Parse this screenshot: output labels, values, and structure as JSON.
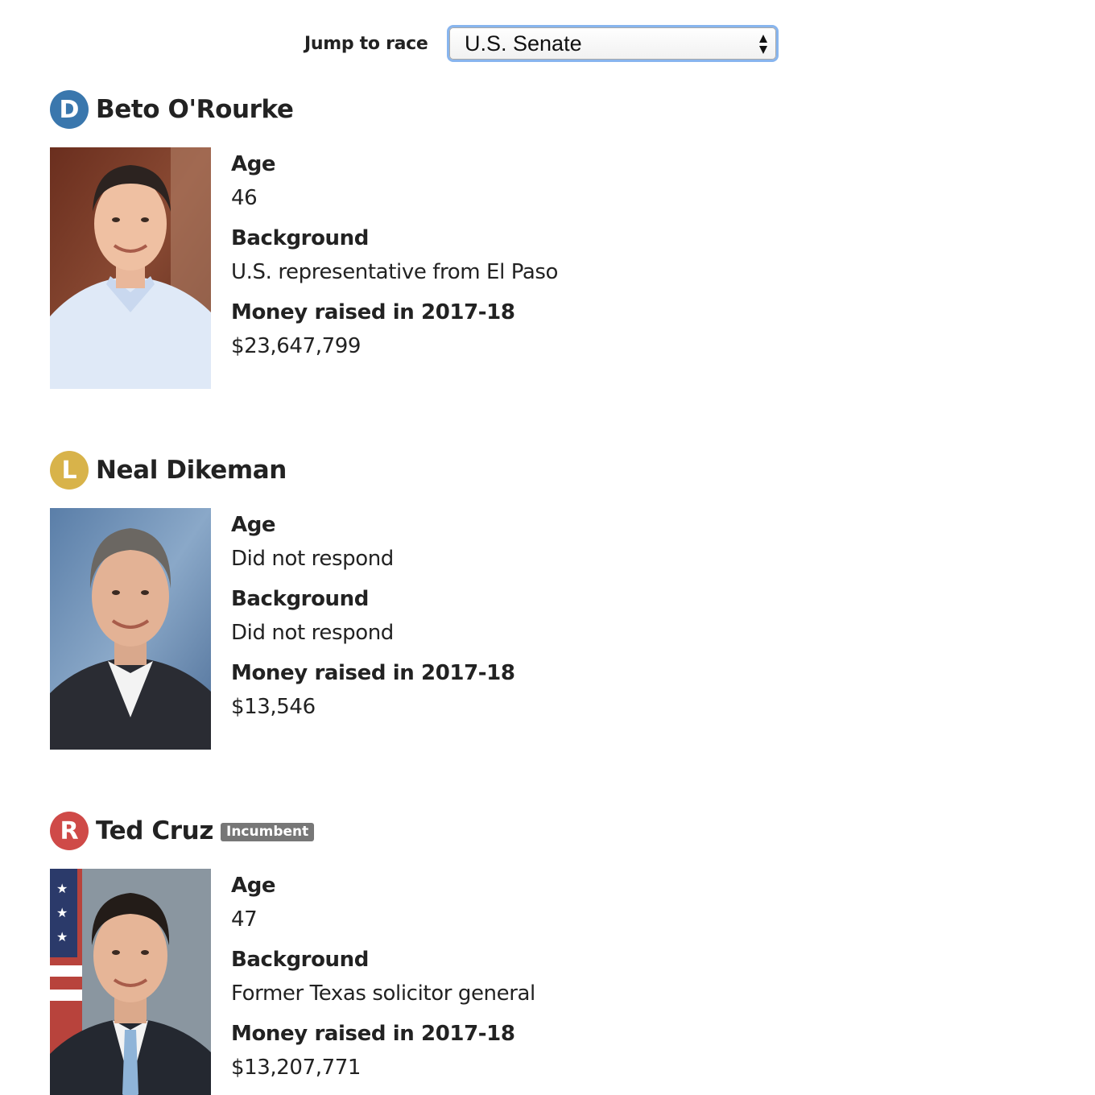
{
  "jump": {
    "label": "Jump to race",
    "selected": "U.S. Senate"
  },
  "labels": {
    "age": "Age",
    "background": "Background",
    "money": "Money raised in 2017-18"
  },
  "colors": {
    "democrat": "#3a77ad",
    "libertarian": "#d8b34a",
    "republican": "#cf4a48",
    "incumbent_tag": "#777777"
  },
  "candidates": [
    {
      "party_letter": "D",
      "name": "Beto O'Rourke",
      "age": "46",
      "background": "U.S. representative from El Paso",
      "money": "$23,647,799"
    },
    {
      "party_letter": "L",
      "name": "Neal Dikeman",
      "age": "Did not respond",
      "background": "Did not respond",
      "money": "$13,546"
    },
    {
      "party_letter": "R",
      "name": "Ted Cruz",
      "incumbent": "Incumbent",
      "age": "47",
      "background": "Former Texas solicitor general",
      "money": "$13,207,771"
    }
  ]
}
